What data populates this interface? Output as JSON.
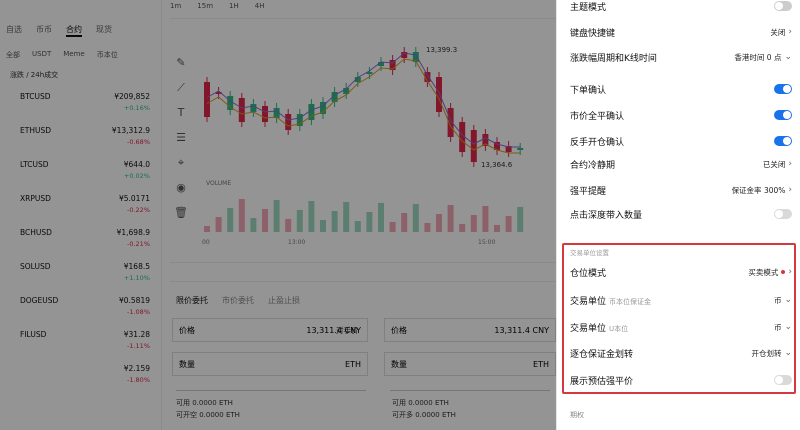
{
  "background": {
    "top_tabs": [
      "自选",
      "币币",
      "合约",
      "现货"
    ],
    "filters": [
      "全部",
      "USDT",
      "Meme",
      "币本位"
    ],
    "sort_label": "涨跌 / 24h成交",
    "coins": [
      {
        "name": "BTCUSD",
        "price": "¥209,852",
        "change": "+0.16%",
        "up": true
      },
      {
        "name": "ETHUSD",
        "price": "¥13,312.9",
        "change": "-0.68%",
        "up": false
      },
      {
        "name": "LTCUSD",
        "price": "¥644.0",
        "change": "+0.02%",
        "up": true
      },
      {
        "name": "XRPUSD",
        "price": "¥5.0171",
        "change": "-0.22%",
        "up": false
      },
      {
        "name": "BCHUSD",
        "price": "¥1,698.9",
        "change": "-0.21%",
        "up": false
      },
      {
        "name": "SOLUSD",
        "price": "¥168.5",
        "change": "+1.10%",
        "up": true
      },
      {
        "name": "DOGEUSD",
        "price": "¥0.5819",
        "change": "-1.08%",
        "up": false
      },
      {
        "name": "FILUSD",
        "price": "¥31.28",
        "change": "-1.11%",
        "up": false
      },
      {
        "name": "",
        "price": "¥2.159",
        "change": "-1.80%",
        "up": false
      }
    ],
    "chart_toolbar": [
      "1m",
      "15m",
      "1H",
      "4H"
    ],
    "chart_top_price": "13,399.3",
    "chart_low_price": "13,364.6",
    "volume_label": "VOLUME",
    "time_ticks": [
      "00",
      "13:00",
      "15:00"
    ],
    "order_tabs": [
      "限价委托",
      "市价委托",
      "止盈止损"
    ],
    "price_value": "13,311.4",
    "price_value_right": "13,311.4",
    "currency": "CNY",
    "counter_price": "对手价",
    "price_label": "价格",
    "qty_label": "数量",
    "unit_eth": "ETH",
    "avail_left": "可用 0.0000 ETH",
    "avail_left2": "可开空 0.0000 ETH",
    "avail_right": "可用 0.0000 ETH",
    "avail_right2": "可开多 0.0000 ETH"
  },
  "panel": {
    "top_item": "主题模式",
    "rows": [
      {
        "label": "键盘快捷键",
        "value": "关闭",
        "type": "chevron"
      },
      {
        "label": "涨跌幅周期和K线时间",
        "value": "香港时间 0 点",
        "type": "dropdown"
      },
      {
        "label": "下单确认",
        "type": "toggle",
        "on": true
      },
      {
        "label": "市价全平确认",
        "type": "toggle",
        "on": true
      },
      {
        "label": "反手开仓确认",
        "type": "toggle",
        "on": true
      },
      {
        "label": "合约冷静期",
        "value": "已关闭",
        "type": "chevron"
      },
      {
        "label": "强平提醒",
        "value": "保证金率 300%",
        "type": "chevron"
      },
      {
        "label": "点击深度带入数量",
        "type": "toggle",
        "on": false
      }
    ],
    "section_title": "交易单位设置",
    "highlight_rows": [
      {
        "label": "仓位模式",
        "value": "买卖模式",
        "type": "chevron",
        "dot": true
      },
      {
        "label": "交易单位",
        "sub": "币本位保证金",
        "value": "币",
        "type": "dropdown"
      },
      {
        "label": "交易单位",
        "sub": "U本位",
        "value": "币",
        "type": "dropdown"
      },
      {
        "label": "逐仓保证金划转",
        "value": "开仓划转",
        "type": "dropdown"
      },
      {
        "label": "展示预估强平价",
        "type": "toggle",
        "on": false
      }
    ],
    "bottom_label": "期权",
    "highlight_color": "#d6383f",
    "accent_color": "#1a73e8",
    "up_color": "#2ebd85",
    "down_color": "#e0294a"
  }
}
